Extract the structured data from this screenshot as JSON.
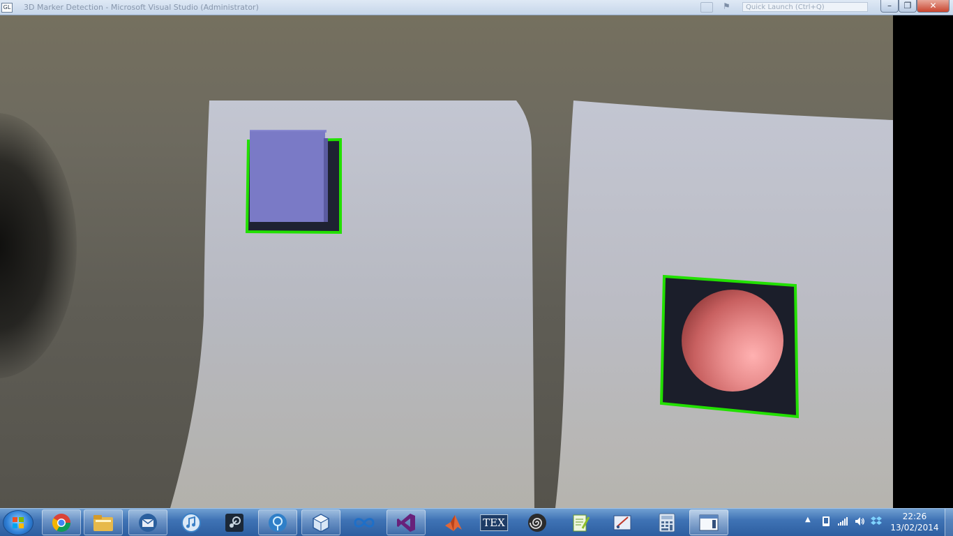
{
  "window": {
    "app_icon_text": "GL",
    "title": "3D Marker Detection - Microsoft Visual Studio (Administrator)",
    "quick_launch_placeholder": "Quick Launch (Ctrl+Q)",
    "controls": {
      "minimize": "–",
      "maximize": "❐",
      "close": "✕"
    }
  },
  "scene": {
    "marker_left": {
      "object": "cube",
      "border_color": "#22e000",
      "object_color": "#7a7ac6"
    },
    "marker_right": {
      "object": "sphere",
      "border_color": "#22e000",
      "object_color": "#e98d8d"
    }
  },
  "taskbar": {
    "start_icon": "windows-start-icon",
    "items": [
      {
        "name": "chrome",
        "icon": "chrome-icon"
      },
      {
        "name": "file-explorer",
        "icon": "folder-icon"
      },
      {
        "name": "thunderbird",
        "icon": "mail-icon"
      },
      {
        "name": "itunes",
        "icon": "music-icon"
      },
      {
        "name": "steam",
        "icon": "steam-icon"
      },
      {
        "name": "sourcetree",
        "icon": "tree-icon"
      },
      {
        "name": "virtualbox",
        "icon": "cube-icon"
      },
      {
        "name": "arduino",
        "icon": "infinity-icon"
      },
      {
        "name": "visual-studio",
        "icon": "visual-studio-icon"
      },
      {
        "name": "matlab",
        "icon": "matlab-icon"
      },
      {
        "name": "texmaker",
        "icon": "tex-icon",
        "label": "TEX"
      },
      {
        "name": "obs",
        "icon": "spiral-icon"
      },
      {
        "name": "notepad-plus",
        "icon": "notepad-icon"
      },
      {
        "name": "snipping-tool",
        "icon": "snipping-icon"
      },
      {
        "name": "calculator",
        "icon": "calculator-icon"
      },
      {
        "name": "running-app",
        "icon": "window-icon"
      }
    ],
    "tray": {
      "show_hidden": "▲",
      "icons": [
        "phone-icon",
        "signal-icon",
        "volume-icon",
        "dropbox-icon"
      ]
    },
    "clock": {
      "time": "22:26",
      "date": "13/02/2014"
    }
  }
}
